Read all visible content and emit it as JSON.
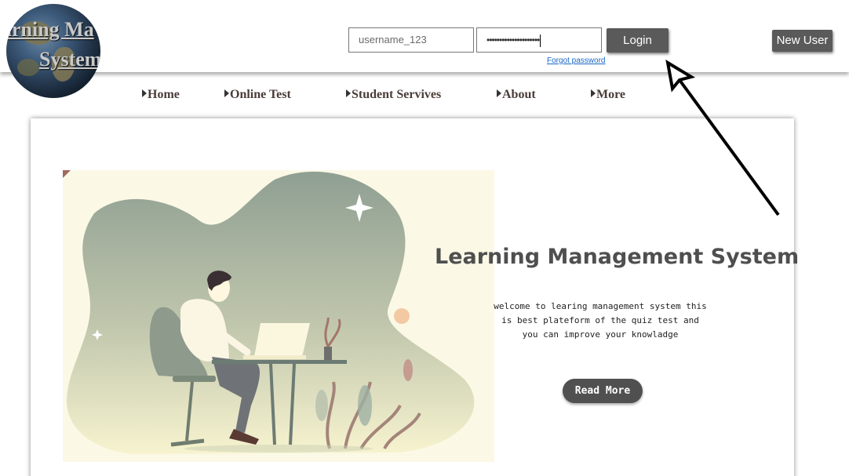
{
  "logo": {
    "line1": "arning Ma",
    "line2": "System"
  },
  "login": {
    "username_value": "username_123",
    "password_value": "•••••••••••••••••••••",
    "login_label": "Login",
    "forgot_label": "Forgot password"
  },
  "new_user_label": "New User",
  "nav": {
    "items": [
      {
        "label": "Home"
      },
      {
        "label": "Online Test"
      },
      {
        "label": "Student Servives"
      },
      {
        "label": "About"
      },
      {
        "label": "More"
      }
    ]
  },
  "hero": {
    "title": "Learning Management System",
    "text_line1": "welcome to learing management system this",
    "text_line2": "is best plateform of the quiz test and",
    "text_line3": "you can improve your knowladge",
    "read_more_label": "Read More"
  },
  "colors": {
    "button_bg": "#5a5a5a",
    "link": "#1a66c5",
    "title": "#4f4f4f"
  }
}
